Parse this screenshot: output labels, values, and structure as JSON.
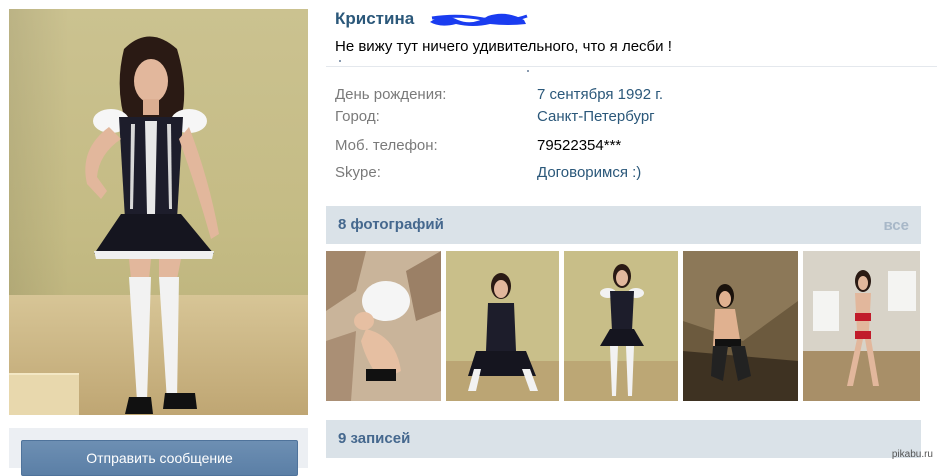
{
  "profile": {
    "name": "Кристина",
    "status": "Не вижу тут ничего удивительного, что я лесби !"
  },
  "info": [
    {
      "label": "День рождения:",
      "value": "7 сентября 1992 г.",
      "is_link": true
    },
    {
      "label": "Город:",
      "value": "Санкт-Петербург",
      "is_link": true
    },
    {
      "label": "Моб. телефон:",
      "value": "79522354***",
      "is_link": false
    },
    {
      "label": "Skype:",
      "value": "Договоримся :)",
      "is_link": true
    }
  ],
  "photos": {
    "title": "8 фотографий",
    "all_link": "все"
  },
  "posts": {
    "title": "9 записей"
  },
  "actions": {
    "send_message": "Отправить сообщение"
  },
  "watermark": "pikabu.ru",
  "colors": {
    "name_link": "#2b587a",
    "section_bg": "#dae2e8",
    "section_title": "#45688e",
    "scribble": "#1a3cf0"
  }
}
